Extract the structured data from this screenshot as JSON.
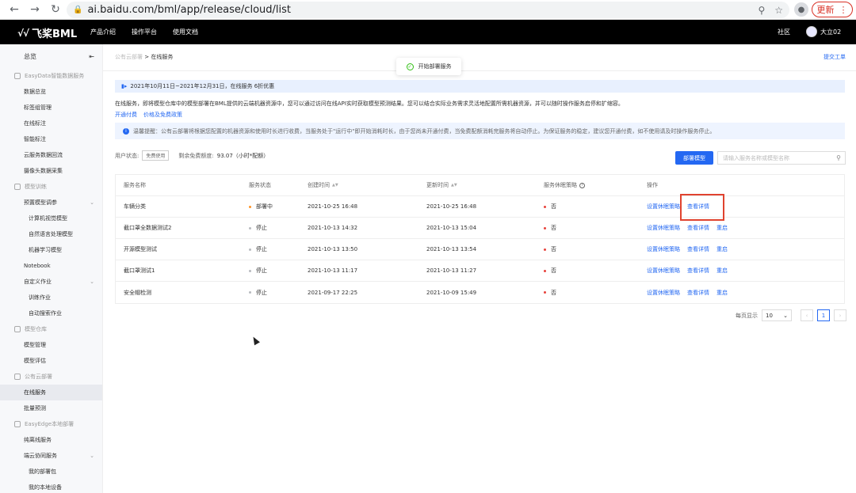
{
  "browser": {
    "url": "ai.baidu.com/bml/app/release/cloud/list",
    "update_label": "更新"
  },
  "topnav": {
    "logo_text": "飞桨BML",
    "menu": [
      "产品介绍",
      "操作平台",
      "使用文档"
    ],
    "community": "社区",
    "username": "大立02"
  },
  "sidebar": {
    "overview": "总览",
    "groups": [
      {
        "label": "EasyData智能数据服务",
        "items": [
          {
            "label": "数据总览"
          },
          {
            "label": "标签组管理"
          },
          {
            "label": "在线标注"
          },
          {
            "label": "智能标注"
          },
          {
            "label": "云服务数据回流"
          },
          {
            "label": "摄像头数据采集"
          }
        ]
      },
      {
        "label": "模型训练",
        "items": [
          {
            "label": "预置模型调参"
          },
          {
            "label": "计算机视觉模型"
          },
          {
            "label": "自然语言处理模型"
          },
          {
            "label": "机器学习模型"
          },
          {
            "label": "Notebook"
          },
          {
            "label": "自定义作业"
          },
          {
            "label": "训练作业"
          },
          {
            "label": "自动搜索作业"
          }
        ]
      },
      {
        "label": "模型仓库",
        "items": [
          {
            "label": "模型管理"
          },
          {
            "label": "模型评估"
          }
        ]
      },
      {
        "label": "公有云部署",
        "items": [
          {
            "label": "在线服务"
          },
          {
            "label": "批量预测"
          }
        ]
      },
      {
        "label": "EasyEdge本地部署",
        "items": [
          {
            "label": "纯离线服务"
          },
          {
            "label": "端云协同服务"
          },
          {
            "label": "我的部署包"
          },
          {
            "label": "我的本地设备"
          }
        ]
      }
    ]
  },
  "main": {
    "breadcrumb_parent": "公有云部署",
    "breadcrumb_sep": ">",
    "breadcrumb_current": "在线服务",
    "submit_ticket": "提交工单",
    "toast": "开始部署服务",
    "notice": "2021年10月11日~2021年12月31日，在线服务 6折优惠",
    "description": "在线服务，即将模型仓库中的模型部署在BML提供的云端机器资源中，您可以通过访问在线API实时获取模型预测结果。您可以结合实际业务需求灵活地配置所需机器资源，并可以随时操作服务启停和扩缩容。",
    "link_pay": "开通付费",
    "link_price": "价格及免费政策",
    "reminder": "温馨提醒：公有云部署将根据您配置的机器资源和使用时长进行收费，当服务处于\"运行中\"即开始消耗时长，由于您尚未开通付费，当免费配额消耗完服务将自动停止。为保证服务的稳定，建议您开通付费，如不使用请及时操作服务停止。",
    "user_status_label": "用户状态:",
    "user_status_tag": "免费使用",
    "quota_label": "剩余免费额度:",
    "quota_value": "93.07（小时*配额）",
    "deploy_button": "部署模型",
    "search_placeholder": "请输入服务名称或模型名称"
  },
  "table": {
    "headers": [
      "服务名称",
      "服务状态",
      "创建时间",
      "更新时间",
      "服务休眠策略",
      "操作"
    ],
    "rows": [
      {
        "name": "车辆分类",
        "status": "部署中",
        "created": "2021-10-25 16:48",
        "updated": "2021-10-25 16:48",
        "sleep": "否",
        "ops": [
          "设置休眠策略",
          "查看详情"
        ]
      },
      {
        "name": "截口罩全数据测试2",
        "status": "停止",
        "created": "2021-10-13 14:32",
        "updated": "2021-10-13 15:04",
        "sleep": "否",
        "ops": [
          "设置休眠策略",
          "查看详情",
          "重启"
        ]
      },
      {
        "name": "开源模型测试",
        "status": "停止",
        "created": "2021-10-13 13:50",
        "updated": "2021-10-13 13:54",
        "sleep": "否",
        "ops": [
          "设置休眠策略",
          "查看详情",
          "重启"
        ]
      },
      {
        "name": "截口罩测试1",
        "status": "停止",
        "created": "2021-10-13 11:17",
        "updated": "2021-10-13 11:27",
        "sleep": "否",
        "ops": [
          "设置休眠策略",
          "查看详情",
          "重启"
        ]
      },
      {
        "name": "安全帽检测",
        "status": "停止",
        "created": "2021-09-17 22:25",
        "updated": "2021-10-09 15:49",
        "sleep": "否",
        "ops": [
          "设置休眠策略",
          "查看详情",
          "重启"
        ]
      }
    ]
  },
  "pager": {
    "per_page_label": "每页显示",
    "per_page": "10",
    "current_page": "1"
  },
  "colors": {
    "accent": "#2468f2",
    "highlight": "#e0432f",
    "deploying": "#ff9326",
    "stopped": "#b8babf",
    "no": "#e8433c"
  }
}
